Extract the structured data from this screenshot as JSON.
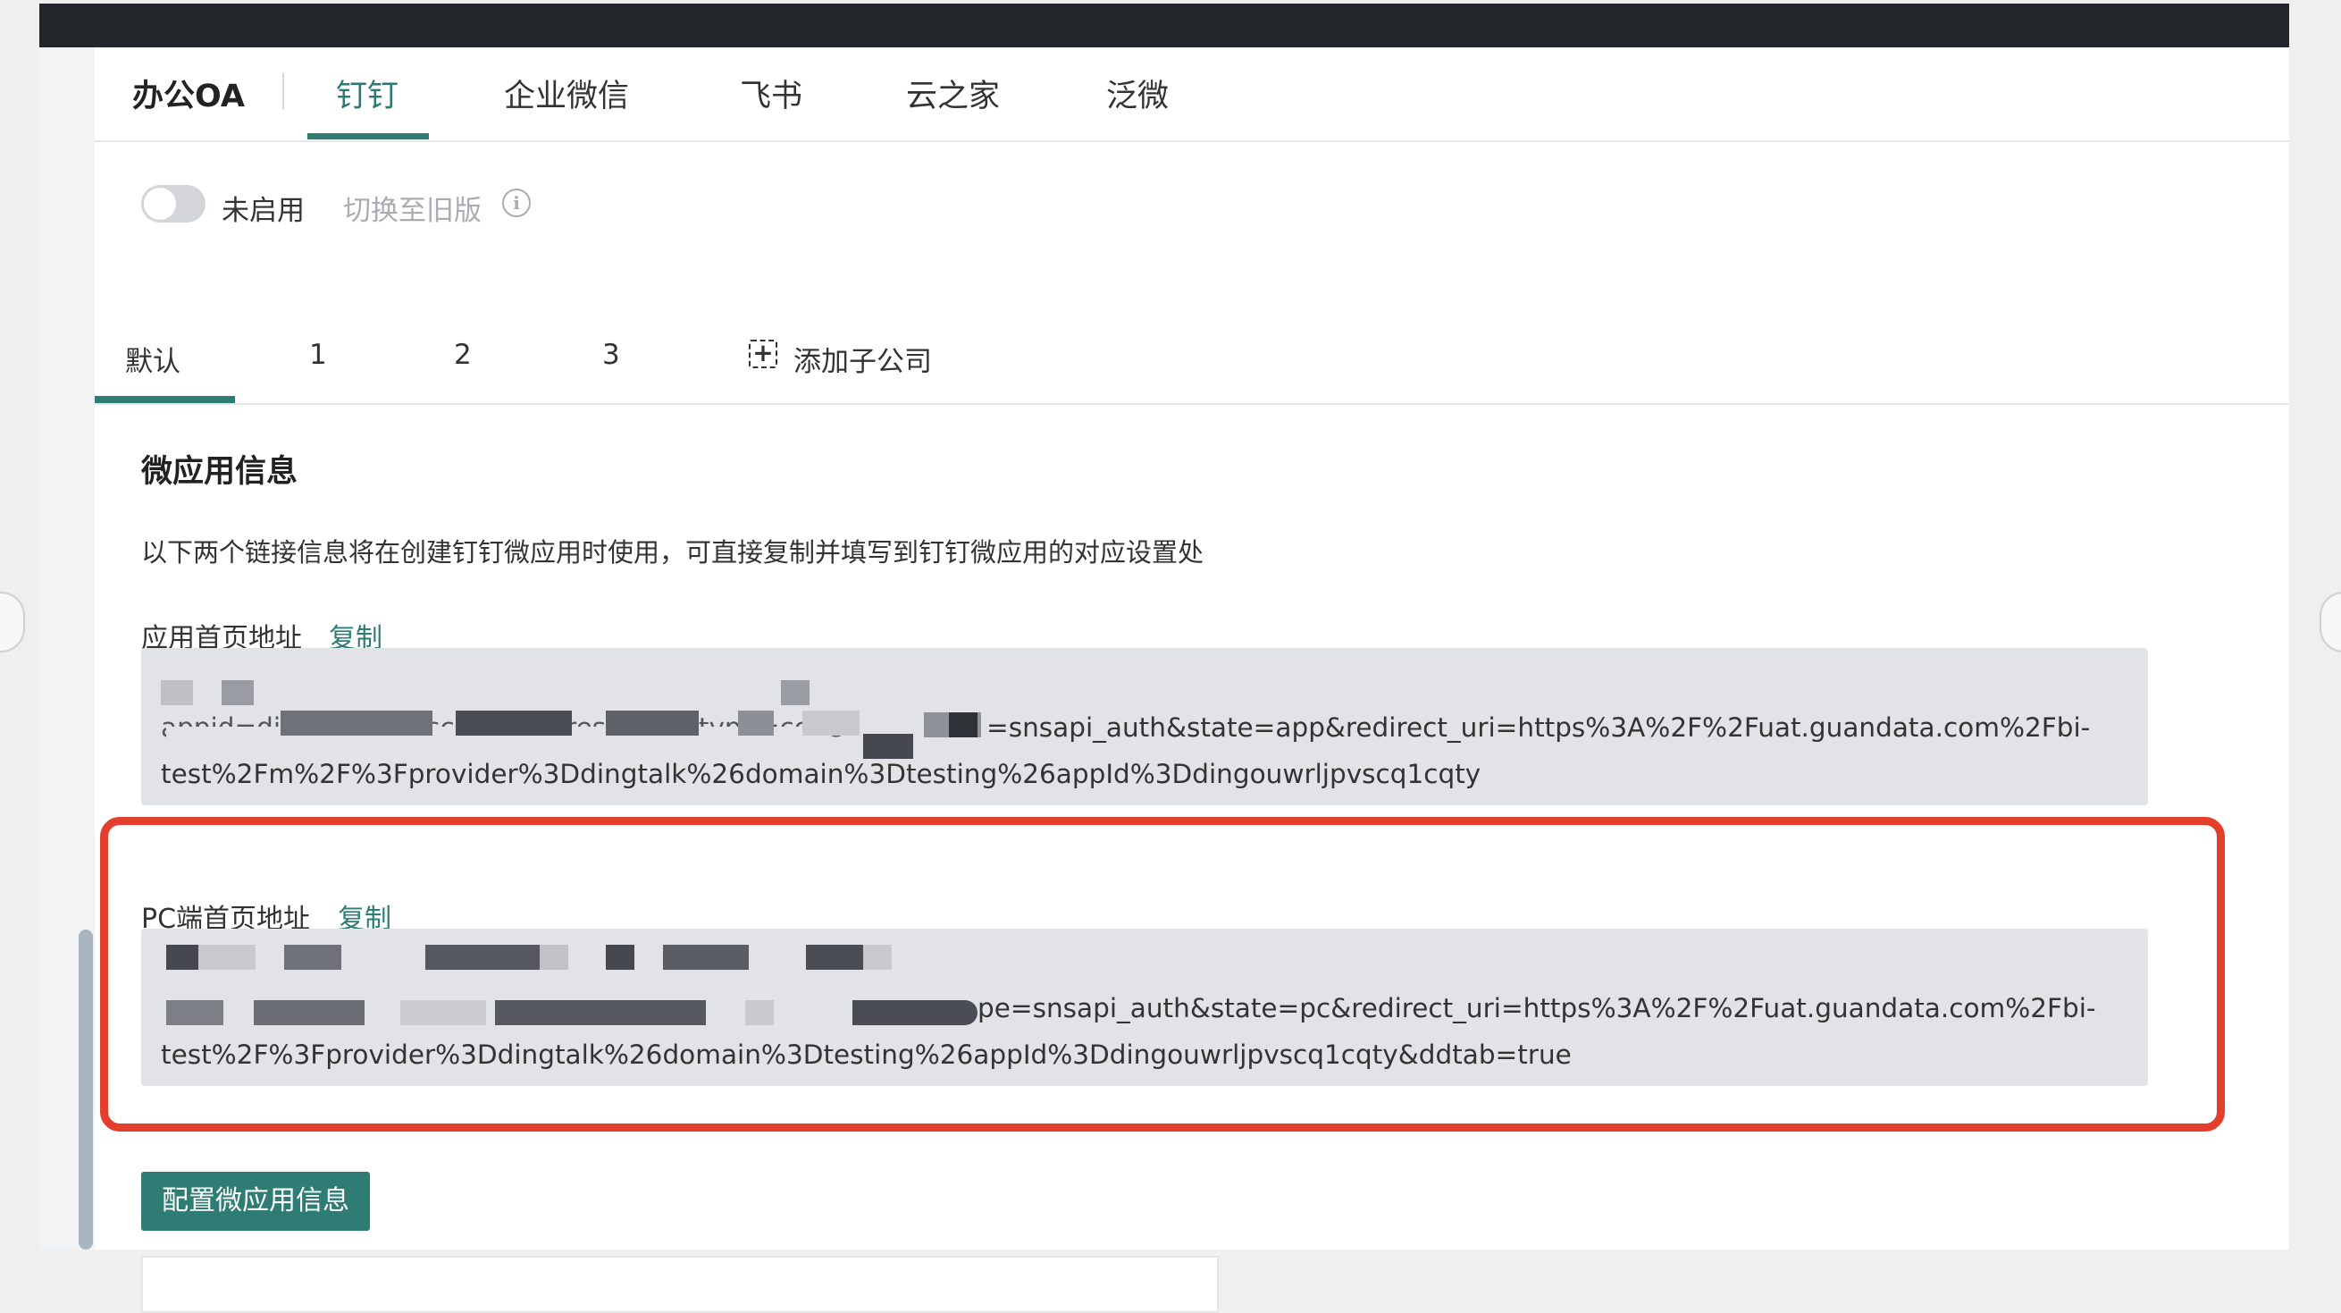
{
  "oa_tabs": {
    "title": "办公OA",
    "items": [
      "钉钉",
      "企业微信",
      "飞书",
      "云之家",
      "泛微"
    ],
    "active": "钉钉"
  },
  "toggle": {
    "state_label": "未启用",
    "switch_old_label": "切换至旧版",
    "enabled": false
  },
  "sub_tabs": {
    "items": [
      "默认",
      "1",
      "2",
      "3"
    ],
    "add_label": "添加子公司",
    "active": "默认"
  },
  "section": {
    "title": "微应用信息",
    "description": "以下两个链接信息将在创建钉钉微应用时使用，可直接复制并填写到钉钉微应用的对应设置处"
  },
  "app_home": {
    "label": "应用首页地址",
    "copy_label": "复制",
    "url_line1_prefix": "appid=dingouwrljpvscq1cqty&response_type=code",
    "url_line1_suffix": "=snsapi_auth&state=app&redirect_uri=https%3A%2F%2Fuat.guandata.com%2Fbi-",
    "url_line2": "test%2Fm%2F%3Fprovider%3Ddingtalk%26domain%3Dtesting%26appId%3Ddingouwrljpvscq1cqty"
  },
  "pc_home": {
    "label": "PC端首页地址",
    "copy_label": "复制",
    "url_line1_suffix": "pe=snsapi_auth&state=pc&redirect_uri=https%3A%2F%2Fuat.guandata.com%2Fbi-",
    "url_line2": "test%2F%3Fprovider%3Ddingtalk%26domain%3Dtesting%26appId%3Ddingouwrljpvscq1cqty&ddtab=true"
  },
  "config_button": {
    "label": "配置微应用信息"
  },
  "colors": {
    "accent": "#2e7c74",
    "highlight": "#e43e2c",
    "topbar": "#23272b",
    "url_box": "#e1e3e6"
  },
  "icons": {
    "info": "info-circle-icon",
    "add": "plus-square-dashed-icon"
  }
}
